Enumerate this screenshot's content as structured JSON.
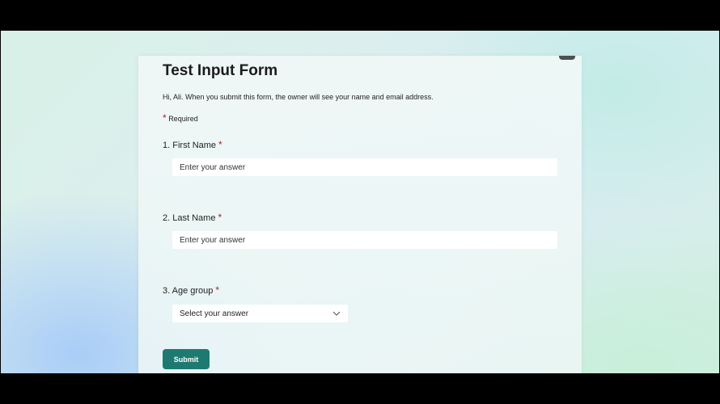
{
  "form": {
    "title": "Test Input Form",
    "description": "Hi, Ali. When you submit this form, the owner will see your name and email address.",
    "required_marker": "*",
    "required_label": "Required",
    "questions": [
      {
        "number": "1.",
        "label": "First Name",
        "required_marker": "*",
        "placeholder": "Enter your answer",
        "type": "text"
      },
      {
        "number": "2.",
        "label": "Last Name",
        "required_marker": "*",
        "placeholder": "Enter your answer",
        "type": "text"
      },
      {
        "number": "3.",
        "label": "Age group",
        "required_marker": "*",
        "placeholder": "Select your answer",
        "type": "select"
      }
    ],
    "submit_label": "Submit"
  },
  "colors": {
    "accent": "#1d7a71",
    "required": "#a4262c"
  },
  "icons": {
    "select_chevron": "chevron-down-icon"
  }
}
